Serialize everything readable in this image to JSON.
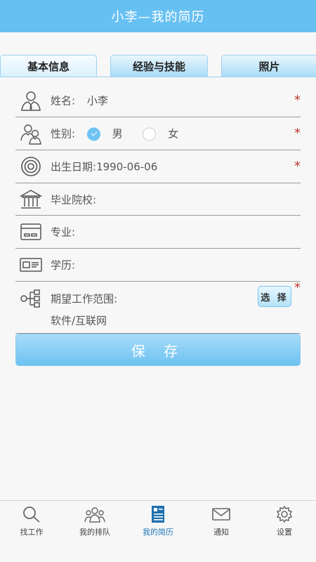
{
  "header": {
    "title": "小李—我的简历"
  },
  "tabs": [
    {
      "label": "基本信息"
    },
    {
      "label": "经验与技能"
    },
    {
      "label": "照片"
    }
  ],
  "form": {
    "name": {
      "label": "姓名:",
      "value": "小李",
      "required_mark": "*"
    },
    "gender": {
      "label": "性别:",
      "options": [
        "男",
        "女"
      ],
      "selected": "男",
      "required_mark": "*"
    },
    "birthdate": {
      "label": "出生日期:",
      "value": "1990-06-06",
      "required_mark": "*"
    },
    "school": {
      "label": "毕业院校:",
      "value": ""
    },
    "major": {
      "label": "专业:",
      "value": ""
    },
    "education": {
      "label": "学历:",
      "value": ""
    },
    "desired_scope": {
      "label": "期望工作范围:",
      "value": "软件/互联网",
      "select_label": "选 择",
      "required_mark": "*"
    }
  },
  "save_label": "保 存",
  "bottom_nav": [
    {
      "label": "找工作",
      "icon": "search-icon"
    },
    {
      "label": "我的排队",
      "icon": "people-icon"
    },
    {
      "label": "我的简历",
      "icon": "resume-icon",
      "active": true
    },
    {
      "label": "通知",
      "icon": "mail-icon"
    },
    {
      "label": "设置",
      "icon": "gear-icon"
    }
  ],
  "colors": {
    "accent": "#67c0f2",
    "required": "#c0392b",
    "active_nav": "#1e78b8"
  }
}
